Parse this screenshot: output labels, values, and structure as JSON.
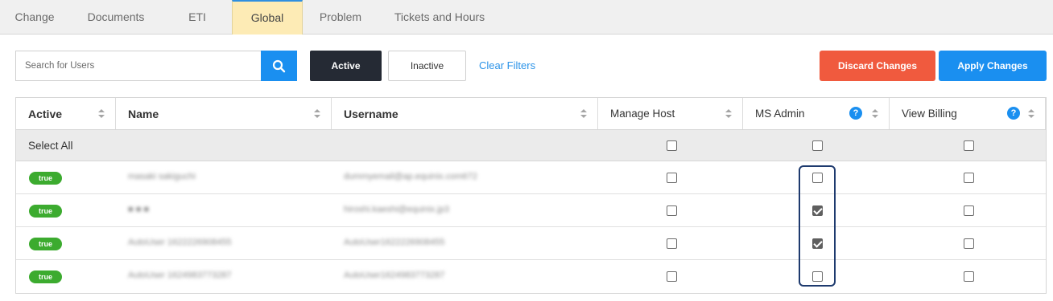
{
  "tabs": [
    {
      "label": "Change",
      "active": false
    },
    {
      "label": "Documents",
      "active": false
    },
    {
      "label": "ETI",
      "active": false
    },
    {
      "label": "Global",
      "active": true
    },
    {
      "label": "Problem",
      "active": false
    },
    {
      "label": "Tickets and Hours",
      "active": false
    }
  ],
  "toolbar": {
    "search_placeholder": "Search for Users",
    "search_value": "",
    "active_label": "Active",
    "inactive_label": "Inactive",
    "clear_filters_label": "Clear Filters",
    "discard_label": "Discard Changes",
    "apply_label": "Apply Changes"
  },
  "colors": {
    "accent": "#1a8ff0",
    "discard": "#f05a3e",
    "active_tab_bg": "#fdebb5",
    "badge_true": "#3cab2f",
    "highlight_border": "#1e3a6e"
  },
  "table": {
    "columns": [
      "Active",
      "Name",
      "Username",
      "Manage Host",
      "MS Admin",
      "View Billing"
    ],
    "select_all_label": "Select All",
    "select_all": {
      "manage_host": false,
      "ms_admin": false,
      "view_billing": false
    },
    "rows": [
      {
        "active": "true",
        "name": "masaki sakiguchi",
        "username": "dummyemail@ap.equinix.com672",
        "manage_host": false,
        "ms_admin": false,
        "view_billing": false
      },
      {
        "active": "true",
        "name": "■ ■ ■",
        "username": "hiroshi.kaeshi@equinix.jp3",
        "manage_host": false,
        "ms_admin": true,
        "view_billing": false
      },
      {
        "active": "true",
        "name": "AutoUser 1622226908455",
        "username": "AutoUser1622226908455",
        "manage_host": false,
        "ms_admin": true,
        "view_billing": false
      },
      {
        "active": "true",
        "name": "AutoUser 1624983773287",
        "username": "AutoUser1624983773287",
        "manage_host": false,
        "ms_admin": false,
        "view_billing": false
      }
    ]
  }
}
